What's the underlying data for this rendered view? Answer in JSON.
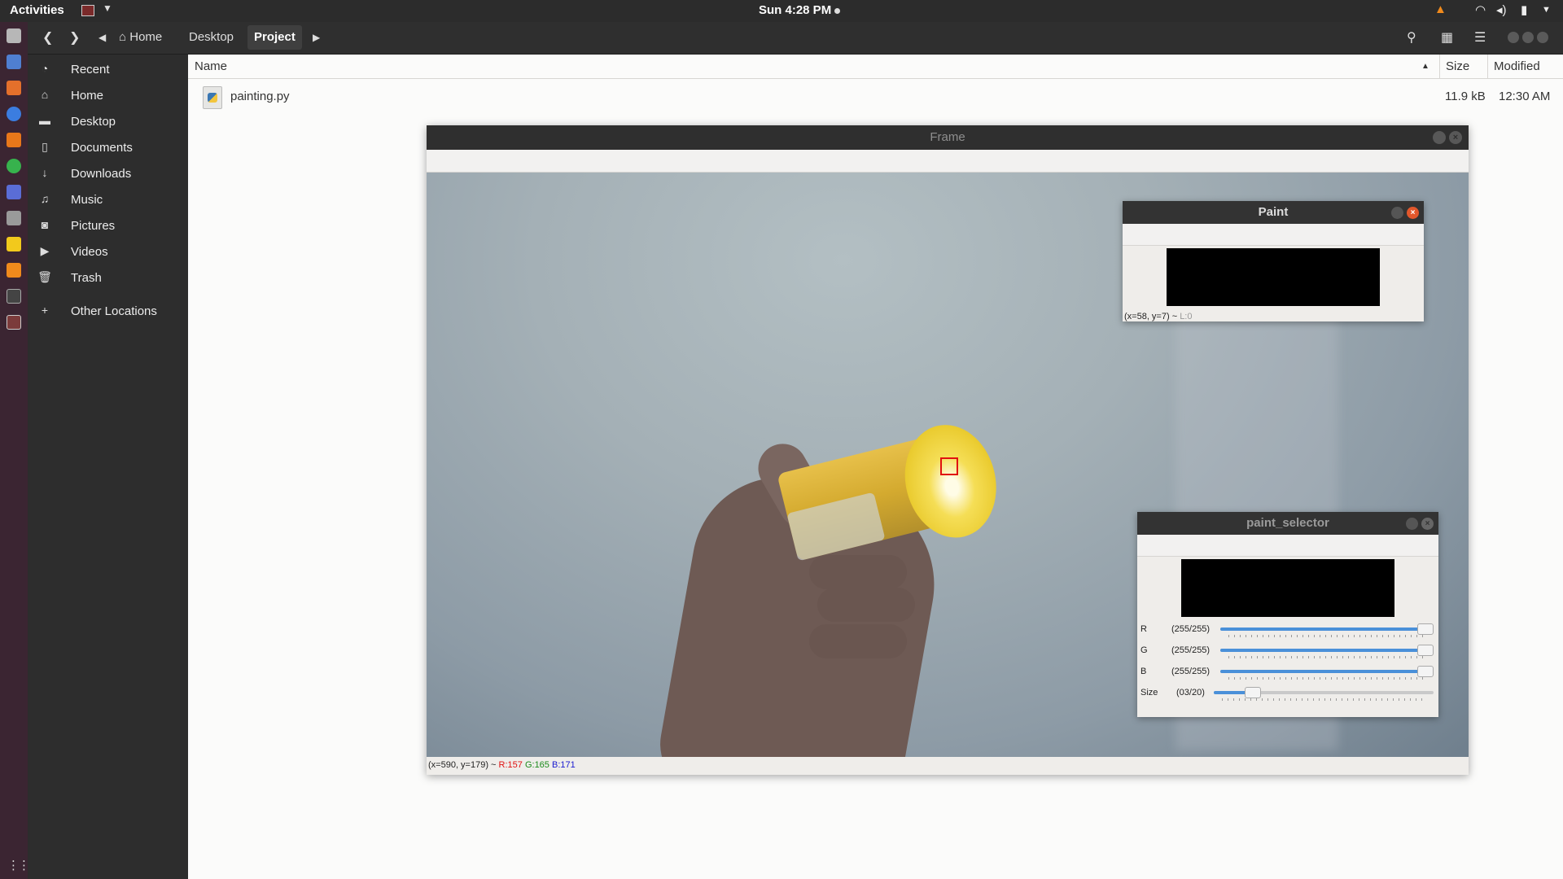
{
  "topbar": {
    "activities": "Activities",
    "clock": "Sun  4:28 PM"
  },
  "files": {
    "breadcrumbs": [
      "Home",
      "Desktop",
      "Project"
    ],
    "sidebar": [
      {
        "label": "Recent",
        "icon": "clock-icon"
      },
      {
        "label": "Home",
        "icon": "home-icon"
      },
      {
        "label": "Desktop",
        "icon": "folder-icon"
      },
      {
        "label": "Documents",
        "icon": "document-icon"
      },
      {
        "label": "Downloads",
        "icon": "download-icon"
      },
      {
        "label": "Music",
        "icon": "music-icon"
      },
      {
        "label": "Pictures",
        "icon": "camera-icon"
      },
      {
        "label": "Videos",
        "icon": "video-icon"
      },
      {
        "label": "Trash",
        "icon": "trash-icon"
      },
      {
        "label": "Other Locations",
        "icon": "plus-icon"
      }
    ],
    "columns": {
      "name": "Name",
      "size": "Size",
      "modified": "Modified"
    },
    "rows": [
      {
        "name": "painting.py",
        "size": "11.9 kB",
        "modified": "12:30 AM"
      }
    ]
  },
  "frame": {
    "title": "Frame",
    "status_prefix": "(x=590, y=179) ~ ",
    "r": "R:157",
    "g": "G:165",
    "b": "B:171"
  },
  "paint": {
    "title": "Paint",
    "status_prefix": "(x=58, y=7) ~ ",
    "status_l": "L:0"
  },
  "paint_selector": {
    "title": "paint_selector",
    "trackbars": [
      {
        "name": "R",
        "value_text": "(255/255)",
        "fraction": 1.0
      },
      {
        "name": "G",
        "value_text": "(255/255)",
        "fraction": 1.0
      },
      {
        "name": "B",
        "value_text": "(255/255)",
        "fraction": 1.0
      },
      {
        "name": "Size",
        "value_text": "(03/20)",
        "fraction": 0.15
      }
    ]
  },
  "colors": {
    "accent": "#4a90d9",
    "tracker": "#e01010",
    "status_r": "#e01010",
    "status_g": "#1a8a1a",
    "status_b": "#1a1ad0"
  }
}
